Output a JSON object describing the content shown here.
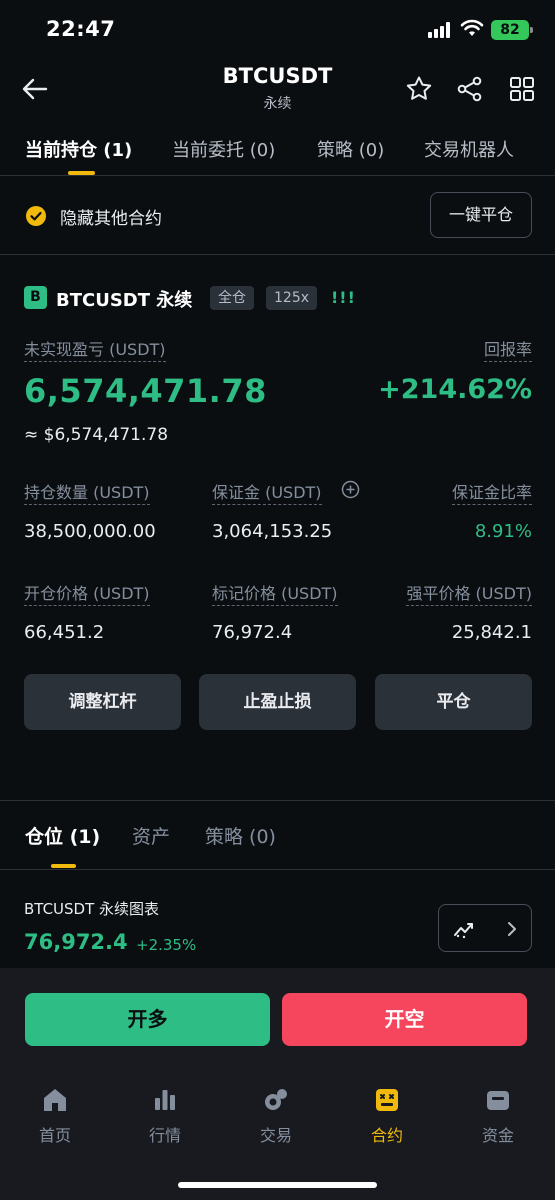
{
  "status_bar": {
    "time": "22:47",
    "battery": "82"
  },
  "header": {
    "title": "BTCUSDT",
    "subtitle": "永续"
  },
  "top_tabs": [
    {
      "label": "当前持仓 (1)",
      "active": true
    },
    {
      "label": "当前委托 (0)",
      "active": false
    },
    {
      "label": "策略 (0)",
      "active": false
    },
    {
      "label": "交易机器人",
      "active": false
    }
  ],
  "hide_other": {
    "label": "隐藏其他合约",
    "checked": true,
    "close_all_label": "一键平仓"
  },
  "position": {
    "side_badge": "B",
    "symbol": "BTCUSDT 永续",
    "margin_mode": "全仓",
    "leverage": "125x",
    "risk_indicator": "!!!",
    "unrealized_pnl_label": "未实现盈亏 (USDT)",
    "unrealized_pnl": "6,574,471.78",
    "unrealized_pnl_usd": "≈ $6,574,471.78",
    "roe_label": "回报率",
    "roe": "+214.62%",
    "size_label": "持仓数量 (USDT)",
    "size": "38,500,000.00",
    "margin_label": "保证金 (USDT)",
    "margin": "3,064,153.25",
    "margin_ratio_label": "保证金比率",
    "margin_ratio": "8.91%",
    "entry_price_label": "开仓价格 (USDT)",
    "entry_price": "66,451.2",
    "mark_price_label": "标记价格 (USDT)",
    "mark_price": "76,972.4",
    "liq_price_label": "强平价格 (USDT)",
    "liq_price": "25,842.1",
    "actions": [
      "调整杠杆",
      "止盈止损",
      "平仓"
    ]
  },
  "bottom_tabs": [
    {
      "label": "仓位 (1)",
      "active": true
    },
    {
      "label": "资产",
      "active": false
    },
    {
      "label": "策略 (0)",
      "active": false
    }
  ],
  "chart_link": {
    "title": "BTCUSDT 永续图表",
    "price": "76,972.4",
    "change": "+2.35%"
  },
  "order_buttons": {
    "long": "开多",
    "short": "开空"
  },
  "bottom_nav": [
    {
      "label": "首页",
      "icon": "home-icon",
      "active": false
    },
    {
      "label": "行情",
      "icon": "markets-icon",
      "active": false
    },
    {
      "label": "交易",
      "icon": "trade-icon",
      "active": false
    },
    {
      "label": "合约",
      "icon": "futures-icon",
      "active": true
    },
    {
      "label": "资金",
      "icon": "wallet-icon",
      "active": false
    }
  ],
  "colors": {
    "accent": "#f0b90b",
    "up": "#2ebd85",
    "down": "#f6465d",
    "background": "#0b0e11"
  }
}
